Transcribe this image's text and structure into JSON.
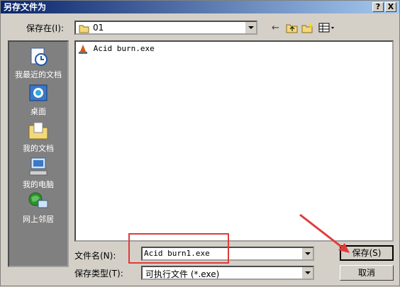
{
  "title": "另存文件为",
  "title_buttons": [
    "?",
    "X"
  ],
  "save_in": {
    "label": "保存在(I):",
    "value": "01"
  },
  "places": [
    "我最近的文档",
    "桌面",
    "我的文档",
    "我的电脑",
    "网上邻居"
  ],
  "files": [
    {
      "name": "Acid burn.exe"
    }
  ],
  "filename": {
    "label": "文件名(N):",
    "value": "Acid burn1.exe"
  },
  "filetype": {
    "label": "保存类型(T):",
    "value": "可执行文件 (*.exe)"
  },
  "buttons": {
    "save": "保存(S)",
    "cancel": "取消"
  },
  "colors": {
    "title_start": "#0a246a",
    "title_end": "#a6caf0",
    "highlight": "#e23a3a"
  }
}
